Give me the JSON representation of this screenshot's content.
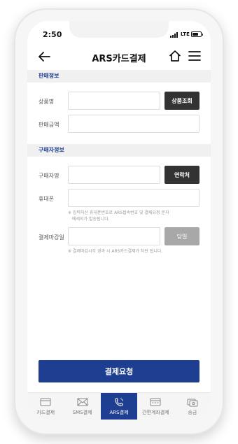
{
  "status": {
    "time": "2:50",
    "network": "LTE"
  },
  "header": {
    "title": "ARS카드결제"
  },
  "sections": {
    "sale": "판매정보",
    "buyer": "구매자정보"
  },
  "fields": {
    "product_name": {
      "label": "상품명",
      "value": "",
      "button": "상품조회"
    },
    "sale_amount": {
      "label": "판매금액",
      "value": ""
    },
    "buyer_name": {
      "label": "구매자명",
      "value": "",
      "button": "연락처"
    },
    "phone": {
      "label": "휴대폰",
      "value": "",
      "notice_line1": "※ 입력하신 휴대폰번호로 ARS접속번호 및 결제요청 문자",
      "notice_line2": "메세지가 발송됩니다."
    },
    "deadline": {
      "label": "결제마감일",
      "value": "",
      "button": "당일",
      "notice": "※ 결제마감시각 경과 시 ARS카드결제가 차단 됩니다."
    }
  },
  "submit": {
    "label": "결제요청"
  },
  "tabs": [
    {
      "label": "카드결제",
      "icon": "card-icon",
      "active": false
    },
    {
      "label": "SMS결제",
      "icon": "envelope-icon",
      "active": false
    },
    {
      "label": "ARS결제",
      "icon": "phone-icon",
      "active": true
    },
    {
      "label": "간편계좌결제",
      "icon": "bank-terminal-icon",
      "active": false
    },
    {
      "label": "송금",
      "icon": "transfer-icon",
      "active": false
    }
  ],
  "colors": {
    "primary": "#1e3f91",
    "dark_button": "#333333",
    "disabled_button": "#a8a8a8"
  }
}
